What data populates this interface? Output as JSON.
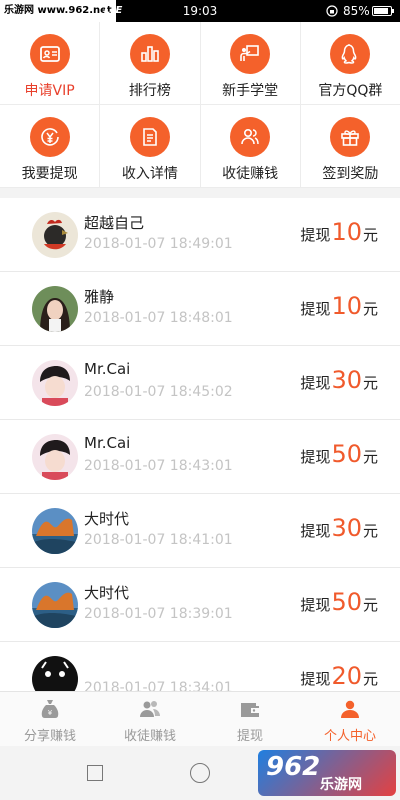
{
  "status_bar": {
    "watermark": "乐游网 www.962.net",
    "carrier": "LTE",
    "time": "19:03",
    "battery": "85%",
    "battery_level": 0.85
  },
  "grid": [
    {
      "label": "申请VIP",
      "icon": "vip-card-icon",
      "highlight": true
    },
    {
      "label": "排行榜",
      "icon": "ranking-icon",
      "highlight": false
    },
    {
      "label": "新手学堂",
      "icon": "teacher-board-icon",
      "highlight": false
    },
    {
      "label": "官方QQ群",
      "icon": "qq-penguin-icon",
      "highlight": false
    },
    {
      "label": "我要提现",
      "icon": "yen-coin-icon",
      "highlight": false
    },
    {
      "label": "收入详情",
      "icon": "document-icon",
      "highlight": false
    },
    {
      "label": "收徒赚钱",
      "icon": "people-icon",
      "highlight": false
    },
    {
      "label": "签到奖励",
      "icon": "gift-icon",
      "highlight": false
    }
  ],
  "withdrawals": [
    {
      "name": "超越自己",
      "time": "2018-01-07 18:49:01",
      "prefix": "提现",
      "amount": "10",
      "unit": "元",
      "avatar": "rooster-avatar"
    },
    {
      "name": "雅静",
      "time": "2018-01-07 18:48:01",
      "prefix": "提现",
      "amount": "10",
      "unit": "元",
      "avatar": "girl-avatar"
    },
    {
      "name": "Mr.Cai",
      "time": "2018-01-07 18:45:02",
      "prefix": "提现",
      "amount": "30",
      "unit": "元",
      "avatar": "boy-avatar"
    },
    {
      "name": "Mr.Cai",
      "time": "2018-01-07 18:43:01",
      "prefix": "提现",
      "amount": "50",
      "unit": "元",
      "avatar": "boy-avatar"
    },
    {
      "name": "大时代",
      "time": "2018-01-07 18:41:01",
      "prefix": "提现",
      "amount": "30",
      "unit": "元",
      "avatar": "landscape-avatar"
    },
    {
      "name": "大时代",
      "time": "2018-01-07 18:39:01",
      "prefix": "提现",
      "amount": "50",
      "unit": "元",
      "avatar": "landscape-avatar"
    },
    {
      "name": "ᅟ",
      "time": "2018-01-07 18:34:01",
      "prefix": "提现",
      "amount": "20",
      "unit": "元",
      "avatar": "dark-avatar"
    }
  ],
  "bottom_nav": [
    {
      "label": "分享赚钱",
      "icon": "money-bag-icon",
      "active": false
    },
    {
      "label": "收徒赚钱",
      "icon": "people-icon",
      "active": false
    },
    {
      "label": "提现",
      "icon": "wallet-icon",
      "active": false
    },
    {
      "label": "个人中心",
      "icon": "person-icon",
      "active": true
    }
  ],
  "brand": {
    "big": "962",
    "small": "乐游网"
  },
  "colors": {
    "accent": "#f4612b",
    "amount": "#f05a2c",
    "date": "#c4c4c4",
    "inactive_nav": "#999999"
  }
}
